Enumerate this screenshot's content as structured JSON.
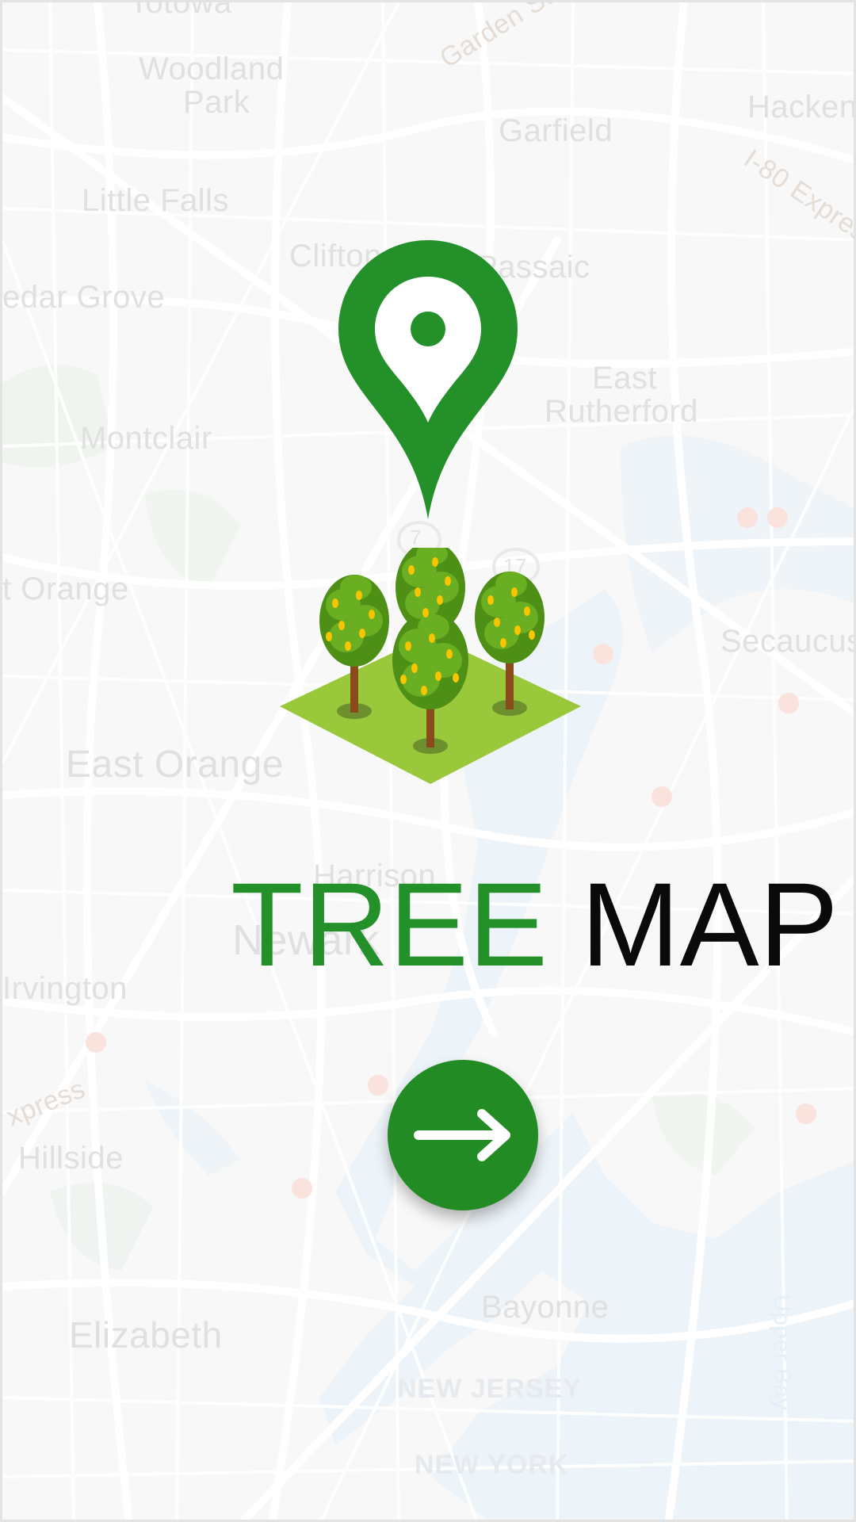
{
  "app": {
    "title_part1": "TREE",
    "title_part2": "MAP"
  },
  "colors": {
    "brand_green": "#238b24",
    "title_dark": "#0a0a0a",
    "tree_leaf": "#5fa31c",
    "tree_fruit": "#f7c600",
    "ground": "#99c93a"
  },
  "map_labels": [
    "Totowa",
    "Woodland",
    "Park",
    "Garden State",
    "Garfield",
    "Hacken",
    "I-80 Expres",
    "Little Falls",
    "Clifton",
    "Passaic",
    "edar Grove",
    "East",
    "Rutherford",
    "Montclair",
    "7",
    "17",
    "t Orange",
    "Secaucus",
    "East Orange",
    "Harrison",
    "Newark",
    "Irvington",
    "xpress",
    "Hillside",
    "Bayonne",
    "Elizabeth",
    "NEW JERSEY",
    "NEW YORK",
    "Upper Bay"
  ],
  "icons": {
    "pin": "location-pin-icon",
    "trees": "trees-icon",
    "arrow": "arrow-right-icon"
  }
}
